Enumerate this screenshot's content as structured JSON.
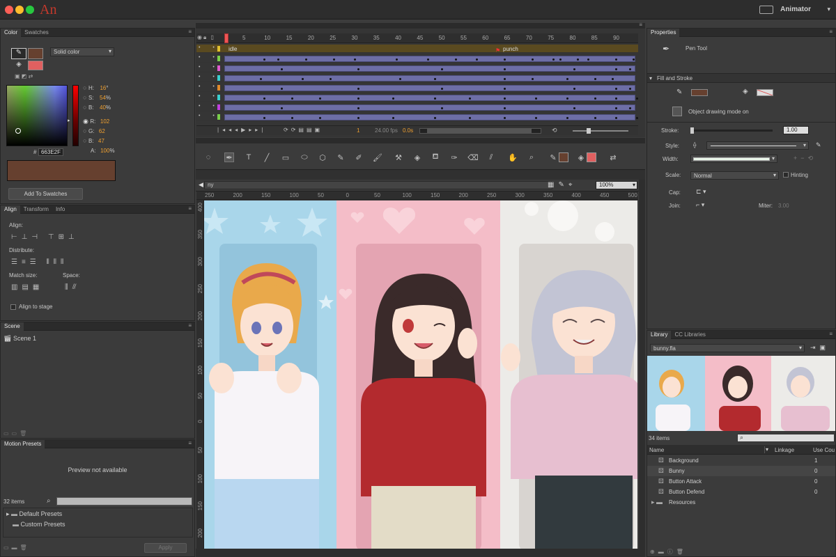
{
  "app": {
    "logo": "An",
    "workspace": "Animator"
  },
  "color_panel": {
    "tabs": [
      "Color",
      "Swatches"
    ],
    "fill_type": "Solid color",
    "hsb": [
      {
        "k": "H:",
        "v": "16",
        "u": "°"
      },
      {
        "k": "S:",
        "v": "54",
        "u": "%"
      },
      {
        "k": "B:",
        "v": "40",
        "u": "%"
      }
    ],
    "rgb": [
      {
        "k": "R:",
        "v": "102"
      },
      {
        "k": "G:",
        "v": "62"
      },
      {
        "k": "B:",
        "v": "47"
      }
    ],
    "alpha": {
      "k": "A:",
      "v": "100",
      "u": "%"
    },
    "hex_prefix": "#",
    "hex": "663E2F",
    "add_swatch": "Add To Swatches",
    "stroke_color": "#66402f",
    "fill_color": "#e06060"
  },
  "align_panel": {
    "tabs": [
      "Align",
      "Transform",
      "Info"
    ],
    "align": "Align:",
    "distribute": "Distribute:",
    "match_size": "Match size:",
    "space": "Space:",
    "align_to_stage": "Align to stage"
  },
  "scene_panel": {
    "tab": "Scene",
    "item": "Scene 1"
  },
  "motion_presets": {
    "tab": "Motion Presets",
    "preview": "Preview not available",
    "count": "32 items",
    "folders": [
      "Default Presets",
      "Custom Presets"
    ],
    "apply": "Apply"
  },
  "timeline": {
    "frames": [
      "5",
      "10",
      "15",
      "20",
      "25",
      "30",
      "35",
      "40",
      "45",
      "50",
      "55",
      "60",
      "65",
      "70",
      "75",
      "80",
      "85",
      "90"
    ],
    "labels": {
      "idle": "idle",
      "punch": "punch"
    },
    "current_frame": "1",
    "fps": "24.00 fps",
    "time": "0.0s"
  },
  "stage": {
    "breadcrumb": "ny",
    "zoom": "100%"
  },
  "ruler": {
    "h": [
      "250",
      "200",
      "150",
      "100",
      "50",
      "0",
      "50",
      "100",
      "150",
      "200",
      "250",
      "300",
      "350",
      "400",
      "450",
      "500"
    ],
    "v": [
      "400",
      "350",
      "300",
      "250",
      "200",
      "150",
      "100",
      "50",
      "0",
      "50",
      "100",
      "150",
      "200"
    ]
  },
  "properties": {
    "tab": "Properties",
    "tool": "Pen Tool",
    "section": "Fill and Stroke",
    "drawing_mode": "Object drawing mode on",
    "stroke_label": "Stroke:",
    "stroke_value": "1.00",
    "style_label": "Style:",
    "width_label": "Width:",
    "scale_label": "Scale:",
    "scale_value": "Normal",
    "hinting": "Hinting",
    "cap_label": "Cap:",
    "join_label": "Join:",
    "miter_label": "Miter:",
    "miter_value": "3.00"
  },
  "library": {
    "tabs": [
      "Library",
      "CC Libraries"
    ],
    "file": "bunny.fla",
    "count": "34 items",
    "columns": {
      "name": "Name",
      "linkage": "Linkage",
      "use": "Use Cou"
    },
    "rows": [
      {
        "name": "Background",
        "use": "1"
      },
      {
        "name": "Bunny",
        "use": "0"
      },
      {
        "name": "Button Attack",
        "use": "0"
      },
      {
        "name": "Button Defend",
        "use": "0"
      },
      {
        "name": "Resources",
        "use": ""
      }
    ]
  }
}
